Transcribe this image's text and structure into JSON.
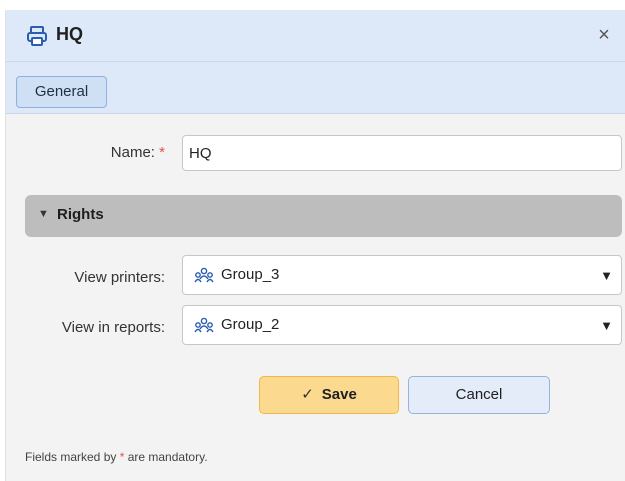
{
  "dialog": {
    "title": "HQ",
    "close_glyph": "×",
    "title_icon": "printer-icon"
  },
  "tabs": [
    {
      "label": "General",
      "active": true
    }
  ],
  "form": {
    "name_label": "Name:",
    "required_marker": "*",
    "name_value": "HQ",
    "section": {
      "caret": "▼",
      "title": "Rights",
      "expanded": true
    },
    "view_printers": {
      "label": "View printers:",
      "value": "Group_3",
      "icon": "user-group-icon"
    },
    "view_in_reports": {
      "label": "View in reports:",
      "value": "Group_2",
      "icon": "user-group-icon"
    }
  },
  "buttons": {
    "save_check": "✓",
    "save_label": "Save",
    "cancel_label": "Cancel"
  },
  "footnote": {
    "before": "Fields marked by ",
    "marker": "*",
    "after": " are mandatory."
  },
  "colors": {
    "header_bg": "#dde9f8",
    "save_bg": "#fbd98e",
    "required": "#d9534f",
    "section_bg": "#bdbdbd"
  }
}
